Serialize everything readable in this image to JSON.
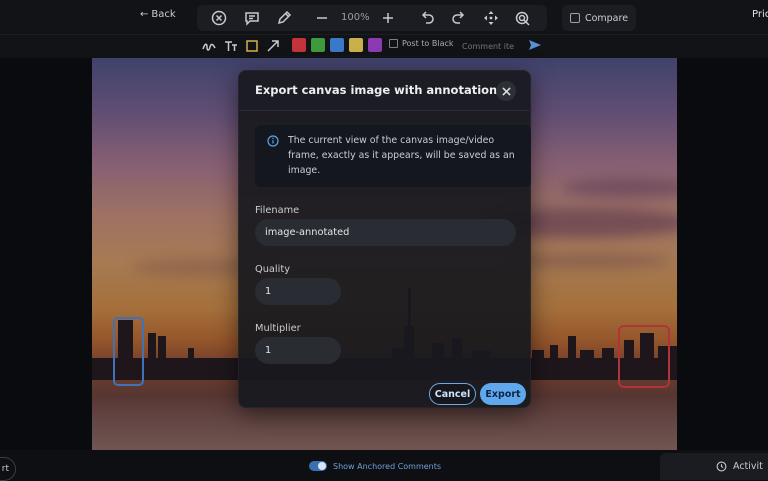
{
  "topbar": {
    "back_label": "Back",
    "zoom": "100%",
    "compare_label": "Compare",
    "pricing_label": "Pric",
    "tools": [
      "close-circle-icon",
      "comment-icon",
      "pen-icon",
      "zoom-out-icon",
      "zoom-in-icon",
      "undo-icon",
      "redo-icon",
      "move-icon",
      "radar-icon"
    ]
  },
  "subbar": {
    "tools": [
      "freehand-icon",
      "text-icon",
      "rectangle-icon",
      "arrow-icon"
    ],
    "colors": [
      "#c2333a",
      "#3f9a3c",
      "#3a78c9",
      "#c9b04b",
      "#8c3ab2"
    ],
    "post_black_label": "Post to Black",
    "comment_placeholder": "Comment ite"
  },
  "modal": {
    "title": "Export canvas image with annotations",
    "info_text": "The current view of the canvas image/video frame, exactly as it appears, will be saved as an image.",
    "filename_label": "Filename",
    "filename_value": "image-annotated",
    "quality_label": "Quality",
    "quality_value": "1",
    "multiplier_label": "Multiplier",
    "multiplier_value": "1",
    "cancel_label": "Cancel",
    "export_label": "Export"
  },
  "bottombar": {
    "left_pill_label": "rt",
    "anchored_comments_label": "Show Anchored Comments",
    "anchored_comments_on": true,
    "activity_label": "Activit"
  },
  "annotations": {
    "blue_color": "#3f72b8",
    "red_color": "#b2343b"
  }
}
